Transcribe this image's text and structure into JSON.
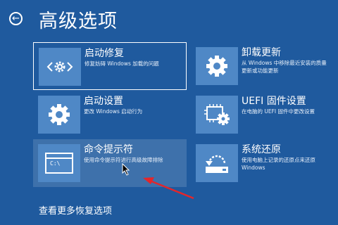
{
  "header": {
    "back_icon": "back-arrow-icon",
    "title": "高级选项"
  },
  "tiles": [
    {
      "id": "startup-repair",
      "title": "启动修复",
      "desc": "修复妨碍 Windows 加载的问题",
      "icon": "code-gear-icon"
    },
    {
      "id": "uninstall-updates",
      "title": "卸载更新",
      "desc": "从 Windows 中移除最近安装的质量更新或功能更新",
      "icon": "gear-icon"
    },
    {
      "id": "startup-settings",
      "title": "启动设置",
      "desc": "更改 Windows 启动行为",
      "icon": "gear-icon"
    },
    {
      "id": "uefi-firmware",
      "title": "UEFI 固件设置",
      "desc": "在电脑的 UEFI 固件中更改设置",
      "icon": "chip-gear-icon"
    },
    {
      "id": "command-prompt",
      "title": "命令提示符",
      "desc": "使用命令提示符进行高级故障排除",
      "icon": "command-prompt-icon",
      "icon_text": "C:\\"
    },
    {
      "id": "system-restore",
      "title": "系统还原",
      "desc": "使用电脑上记录的还原点来还原 Windows",
      "icon": "system-restore-icon"
    }
  ],
  "footer": {
    "more_options": "查看更多恢复选项"
  },
  "colors": {
    "background": "#1f5a9e",
    "tile_icon": "#4f88c6",
    "annotation": "#e3262b"
  }
}
